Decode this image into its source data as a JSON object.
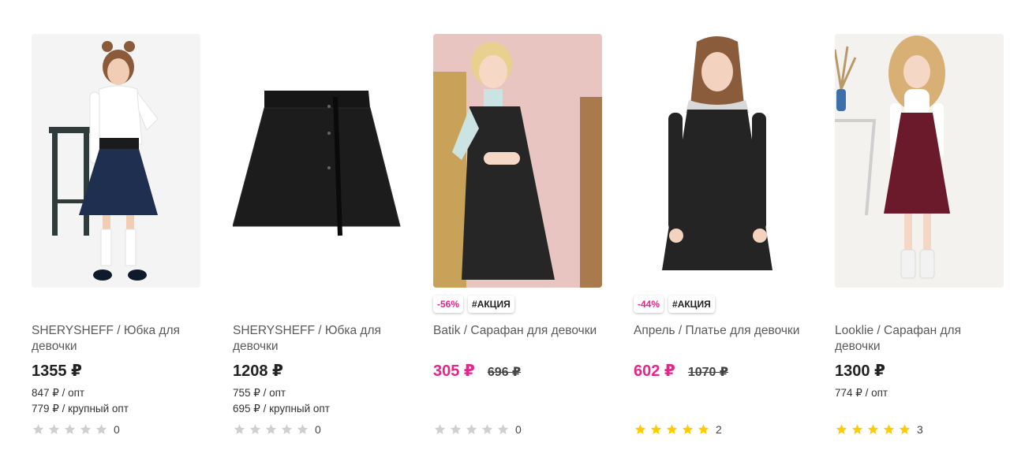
{
  "colors": {
    "sale_pink": "#e6258a",
    "star_gold": "#ffcc00",
    "star_grey": "#cfcfcf"
  },
  "products": [
    {
      "brand_title": "SHERYSHEFF / Юбка для девочки",
      "price": "1355 ₽",
      "wholesale": "847 ₽ / опт",
      "bulk_wholesale": "779 ₽ / крупный опт",
      "rating_count": "0",
      "stars_filled": 0,
      "image_icon": "girl-navy-skirt-photo"
    },
    {
      "brand_title": "SHERYSHEFF / Юбка для девочки",
      "price": "1208 ₽",
      "wholesale": "755 ₽ / опт",
      "bulk_wholesale": "695 ₽ / крупный опт",
      "rating_count": "0",
      "stars_filled": 0,
      "image_icon": "black-skirt-photo"
    },
    {
      "brand_title": "Batik / Сарафан для девочки",
      "discount": "-56%",
      "promo": "#АКЦИЯ",
      "price": "305 ₽",
      "old_price": "696 ₽",
      "rating_count": "0",
      "stars_filled": 0,
      "image_icon": "girl-black-sundress-photo"
    },
    {
      "brand_title": "Апрель / Платье для девочки",
      "discount": "-44%",
      "promo": "#АКЦИЯ",
      "price": "602 ₽",
      "old_price": "1070 ₽",
      "rating_count": "2",
      "stars_filled": 5,
      "image_icon": "girl-black-dress-photo"
    },
    {
      "brand_title": "Looklie / Сарафан для девочки",
      "price": "1300 ₽",
      "wholesale": "774 ₽ / опт",
      "rating_count": "3",
      "stars_filled": 5,
      "image_icon": "girl-burgundy-sundress-photo"
    }
  ]
}
